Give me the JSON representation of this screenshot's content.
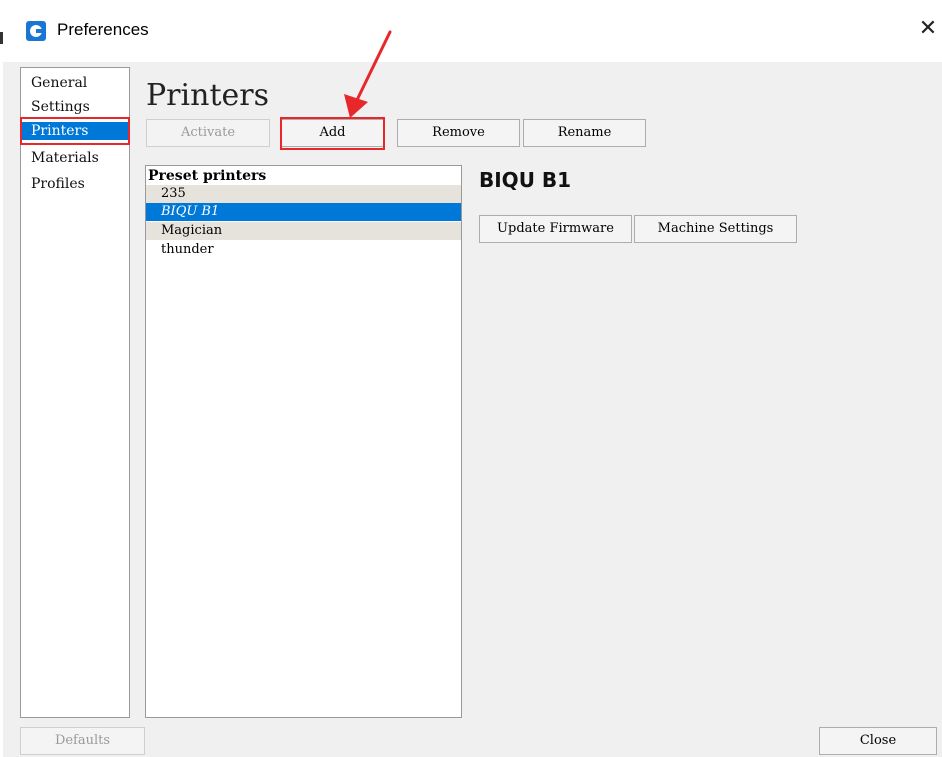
{
  "window": {
    "title": "Preferences",
    "close_glyph": "✕",
    "icon": "app-logo-icon"
  },
  "sidebar": {
    "items": [
      {
        "label": "General"
      },
      {
        "label": "Settings"
      },
      {
        "label": "Printers",
        "selected": true
      },
      {
        "label": "Materials"
      },
      {
        "label": "Profiles"
      }
    ]
  },
  "page": {
    "title": "Printers"
  },
  "toolbar": {
    "activate_label": "Activate",
    "add_label": "Add",
    "remove_label": "Remove",
    "rename_label": "Rename"
  },
  "printer_list": {
    "header": "Preset printers",
    "items": [
      {
        "name": "235"
      },
      {
        "name": "BIQU B1",
        "selected": true
      },
      {
        "name": "Magician"
      },
      {
        "name": "thunder"
      }
    ]
  },
  "detail": {
    "printer_name": "BIQU B1",
    "update_firmware_label": "Update Firmware",
    "machine_settings_label": "Machine Settings"
  },
  "footer": {
    "defaults_label": "Defaults",
    "close_label": "Close"
  },
  "colors": {
    "selection": "#0078d7",
    "annotation": "#e8272b",
    "brand": "#1976d2"
  }
}
